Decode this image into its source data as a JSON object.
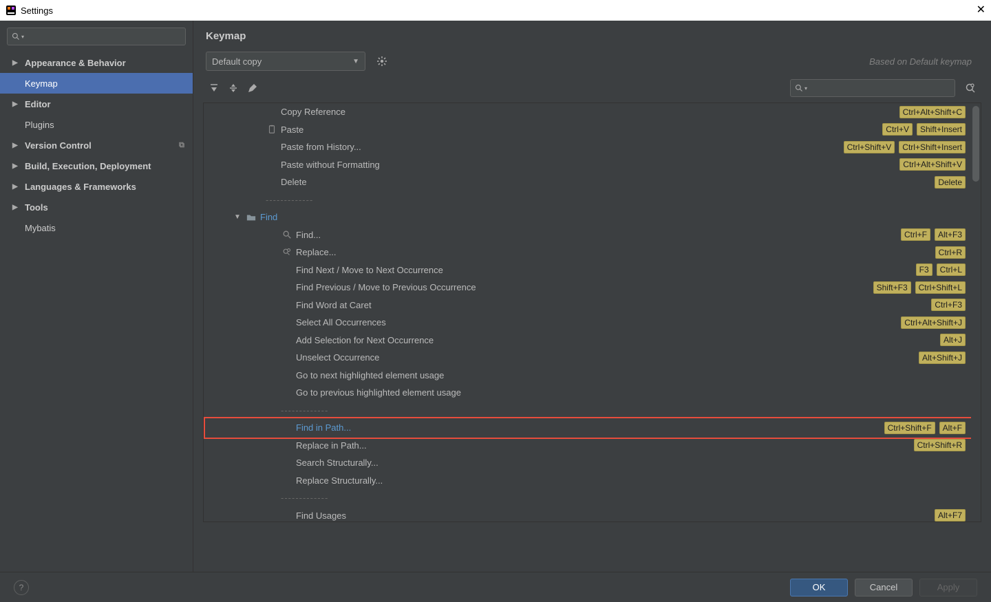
{
  "window": {
    "title": "Settings"
  },
  "sidebar": {
    "items": [
      {
        "label": "Appearance & Behavior",
        "arrow": true,
        "bold": true
      },
      {
        "label": "Keymap",
        "indent": true,
        "selected": true
      },
      {
        "label": "Editor",
        "arrow": true,
        "bold": true
      },
      {
        "label": "Plugins",
        "indent": true
      },
      {
        "label": "Version Control",
        "arrow": true,
        "bold": true,
        "badge": "⧉"
      },
      {
        "label": "Build, Execution, Deployment",
        "arrow": true,
        "bold": true
      },
      {
        "label": "Languages & Frameworks",
        "arrow": true,
        "bold": true
      },
      {
        "label": "Tools",
        "arrow": true,
        "bold": true
      },
      {
        "label": "Mybatis",
        "indent": true
      }
    ]
  },
  "header": {
    "title": "Keymap",
    "combo": "Default copy",
    "based": "Based on Default keymap"
  },
  "tree": [
    {
      "type": "item",
      "indent": 0,
      "label": "Copy Reference",
      "shortcuts": [
        "Ctrl+Alt+Shift+C"
      ]
    },
    {
      "type": "item",
      "indent": 0,
      "icon": "paste",
      "label": "Paste",
      "shortcuts": [
        "Ctrl+V",
        "Shift+Insert"
      ]
    },
    {
      "type": "item",
      "indent": 0,
      "label": "Paste from History...",
      "shortcuts": [
        "Ctrl+Shift+V",
        "Ctrl+Shift+Insert"
      ]
    },
    {
      "type": "item",
      "indent": 0,
      "label": "Paste without Formatting",
      "shortcuts": [
        "Ctrl+Alt+Shift+V"
      ]
    },
    {
      "type": "item",
      "indent": 0,
      "label": "Delete",
      "shortcuts": [
        "Delete"
      ]
    },
    {
      "type": "sep",
      "indent": 0
    },
    {
      "type": "group",
      "label": "Find"
    },
    {
      "type": "item",
      "indent": 1,
      "icon": "search",
      "label": "Find...",
      "shortcuts": [
        "Ctrl+F",
        "Alt+F3"
      ]
    },
    {
      "type": "item",
      "indent": 1,
      "icon": "replace",
      "label": "Replace...",
      "shortcuts": [
        "Ctrl+R"
      ]
    },
    {
      "type": "item",
      "indent": 1,
      "label": "Find Next / Move to Next Occurrence",
      "shortcuts": [
        "F3",
        "Ctrl+L"
      ]
    },
    {
      "type": "item",
      "indent": 1,
      "label": "Find Previous / Move to Previous Occurrence",
      "shortcuts": [
        "Shift+F3",
        "Ctrl+Shift+L"
      ]
    },
    {
      "type": "item",
      "indent": 1,
      "label": "Find Word at Caret",
      "shortcuts": [
        "Ctrl+F3"
      ]
    },
    {
      "type": "item",
      "indent": 1,
      "label": "Select All Occurrences",
      "shortcuts": [
        "Ctrl+Alt+Shift+J"
      ]
    },
    {
      "type": "item",
      "indent": 1,
      "label": "Add Selection for Next Occurrence",
      "shortcuts": [
        "Alt+J"
      ]
    },
    {
      "type": "item",
      "indent": 1,
      "label": "Unselect Occurrence",
      "shortcuts": [
        "Alt+Shift+J"
      ]
    },
    {
      "type": "item",
      "indent": 1,
      "label": "Go to next highlighted element usage",
      "shortcuts": []
    },
    {
      "type": "item",
      "indent": 1,
      "label": "Go to previous highlighted element usage",
      "shortcuts": []
    },
    {
      "type": "sep",
      "indent": 1
    },
    {
      "type": "item",
      "indent": 1,
      "link": true,
      "label": "Find in Path...",
      "shortcuts": [
        "Ctrl+Shift+F",
        "Alt+F"
      ],
      "highlight": true
    },
    {
      "type": "item",
      "indent": 1,
      "label": "Replace in Path...",
      "shortcuts": [
        "Ctrl+Shift+R"
      ]
    },
    {
      "type": "item",
      "indent": 1,
      "label": "Search Structurally...",
      "shortcuts": []
    },
    {
      "type": "item",
      "indent": 1,
      "label": "Replace Structurally...",
      "shortcuts": []
    },
    {
      "type": "sep",
      "indent": 1
    },
    {
      "type": "item",
      "indent": 1,
      "label": "Find Usages",
      "shortcuts": [
        "Alt+F7"
      ]
    }
  ],
  "footer": {
    "ok": "OK",
    "cancel": "Cancel",
    "apply": "Apply"
  },
  "separator": "-------------"
}
